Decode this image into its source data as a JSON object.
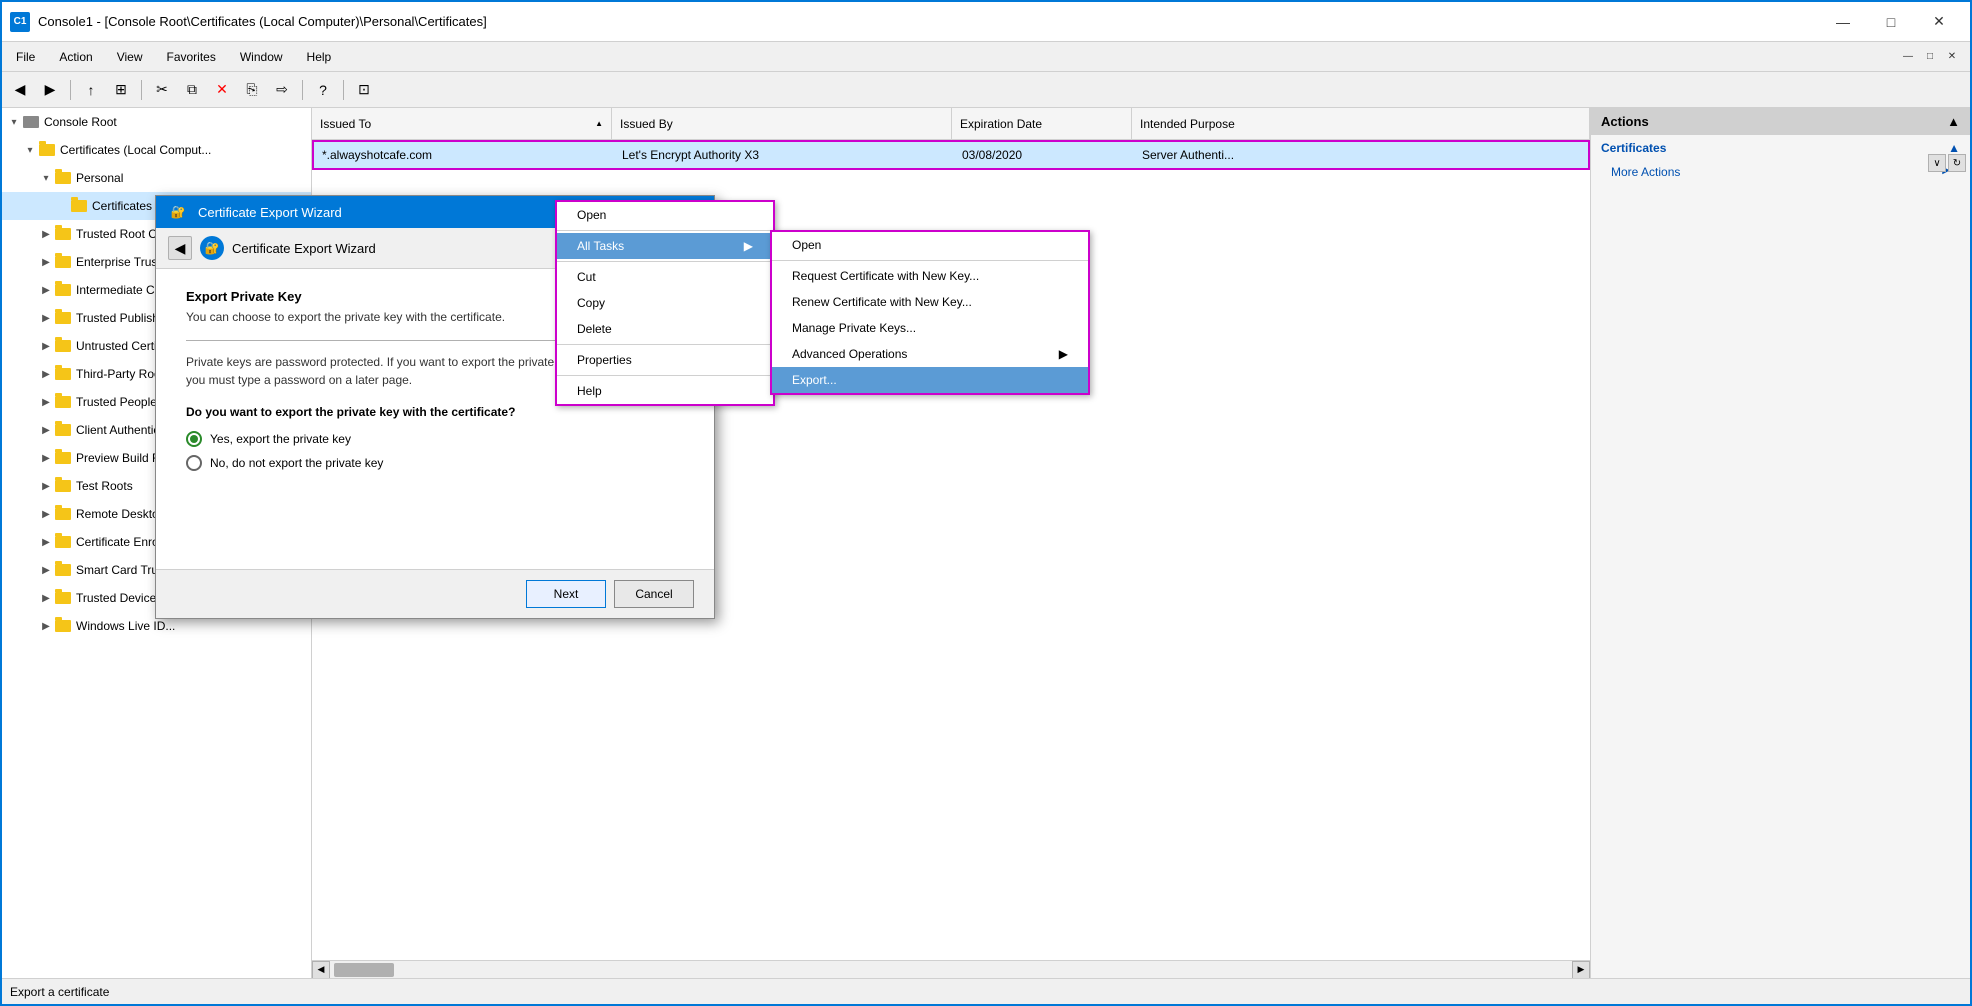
{
  "window": {
    "title": "Console1 - [Console Root\\Certificates (Local Computer)\\Personal\\Certificates]",
    "icon_label": "C1"
  },
  "titlebar": {
    "minimize": "—",
    "maximize": "□",
    "close": "✕"
  },
  "menubar": {
    "items": [
      "File",
      "Action",
      "View",
      "Favorites",
      "Window",
      "Help"
    ]
  },
  "toolbar": {
    "buttons": [
      "◀",
      "▶",
      "↑",
      "⊞",
      "✂",
      "⧉",
      "✕",
      "⎘",
      "⇨",
      "?",
      "⊡"
    ]
  },
  "tree": {
    "items": [
      {
        "label": "Console Root",
        "indent": 0,
        "expand": "▾",
        "icon": "computer",
        "id": "console-root"
      },
      {
        "label": "Certificates (Local Comput...",
        "indent": 1,
        "expand": "▾",
        "icon": "folder",
        "id": "certs-local"
      },
      {
        "label": "Personal",
        "indent": 2,
        "expand": "▾",
        "icon": "folder",
        "id": "personal"
      },
      {
        "label": "Certificates",
        "indent": 3,
        "expand": "",
        "icon": "folder",
        "id": "certificates",
        "selected": true
      },
      {
        "label": "Trusted Root Cert...",
        "indent": 2,
        "expand": "▶",
        "icon": "folder",
        "id": "trusted-root"
      },
      {
        "label": "Enterprise Trust",
        "indent": 2,
        "expand": "▶",
        "icon": "folder",
        "id": "enterprise-trust"
      },
      {
        "label": "Intermediate Cert",
        "indent": 2,
        "expand": "▶",
        "icon": "folder",
        "id": "intermediate-cert"
      },
      {
        "label": "Trusted Publisher",
        "indent": 2,
        "expand": "▶",
        "icon": "folder",
        "id": "trusted-publisher"
      },
      {
        "label": "Untrusted Certific...",
        "indent": 2,
        "expand": "▶",
        "icon": "folder",
        "id": "untrusted-cert"
      },
      {
        "label": "Third-Party Root...",
        "indent": 2,
        "expand": "▶",
        "icon": "folder",
        "id": "third-party-root"
      },
      {
        "label": "Trusted People",
        "indent": 2,
        "expand": "▶",
        "icon": "folder",
        "id": "trusted-people"
      },
      {
        "label": "Client Authentic...",
        "indent": 2,
        "expand": "▶",
        "icon": "folder",
        "id": "client-auth"
      },
      {
        "label": "Preview Build Ro...",
        "indent": 2,
        "expand": "▶",
        "icon": "folder",
        "id": "preview-build"
      },
      {
        "label": "Test Roots",
        "indent": 2,
        "expand": "▶",
        "icon": "folder",
        "id": "test-roots"
      },
      {
        "label": "Remote Desktop...",
        "indent": 2,
        "expand": "▶",
        "icon": "folder",
        "id": "remote-desktop"
      },
      {
        "label": "Certificate Enrol...",
        "indent": 2,
        "expand": "▶",
        "icon": "folder",
        "id": "cert-enroll"
      },
      {
        "label": "Smart Card Trus...",
        "indent": 2,
        "expand": "▶",
        "icon": "folder",
        "id": "smart-card"
      },
      {
        "label": "Trusted Devices",
        "indent": 2,
        "expand": "▶",
        "icon": "folder",
        "id": "trusted-devices"
      },
      {
        "label": "Windows Live ID...",
        "indent": 2,
        "expand": "▶",
        "icon": "folder",
        "id": "windows-live"
      }
    ]
  },
  "columns": {
    "headers": [
      "Issued To",
      "Issued By",
      "Expiration Date",
      "Intended Purpose"
    ]
  },
  "cert_row": {
    "issued_to": "*.alwayshotcafe.com",
    "issued_by": "Let's Encrypt Authority X3",
    "expiration": "03/08/2020",
    "purpose": "Server Authenti..."
  },
  "context_menu": {
    "items": [
      {
        "label": "Open",
        "id": "ctx-open",
        "highlighted": false
      },
      {
        "label": "All Tasks",
        "id": "ctx-all-tasks",
        "highlighted": true,
        "has_arrow": true
      },
      {
        "label": "Cut",
        "id": "ctx-cut",
        "highlighted": false
      },
      {
        "label": "Copy",
        "id": "ctx-copy",
        "highlighted": false
      },
      {
        "label": "Delete",
        "id": "ctx-delete",
        "highlighted": false
      },
      {
        "label": "Properties",
        "id": "ctx-properties",
        "highlighted": false
      },
      {
        "label": "Help",
        "id": "ctx-help",
        "highlighted": false
      }
    ],
    "separators_after": [
      0,
      1,
      4,
      5
    ]
  },
  "submenu": {
    "items": [
      {
        "label": "Open",
        "id": "sub-open",
        "highlighted": false
      },
      {
        "label": "Request Certificate with New Key...",
        "id": "sub-request",
        "highlighted": false
      },
      {
        "label": "Renew Certificate with New Key...",
        "id": "sub-renew",
        "highlighted": false
      },
      {
        "label": "Manage Private Keys...",
        "id": "sub-manage-keys",
        "highlighted": false
      },
      {
        "label": "Advanced Operations",
        "id": "sub-advanced",
        "highlighted": false,
        "has_arrow": true
      },
      {
        "label": "Export...",
        "id": "sub-export",
        "highlighted": true
      }
    ],
    "separators_after": [
      0
    ]
  },
  "actions_panel": {
    "header": "Actions",
    "certificates_label": "Certificates",
    "more_actions_label": "More Actions",
    "arrow": "▶"
  },
  "dialog": {
    "title": "Certificate Export Wizard",
    "nav_title": "Certificate Export Wizard",
    "section_title": "Export Private Key",
    "section_desc": "You can choose to export the private key with the certificate.",
    "body_text": "Private keys are password protected. If you want to export the private key with the certificate, you must type a password on a later page.",
    "question": "Do you want to export the private key with the certificate?",
    "radio_yes": "Yes, export the private key",
    "radio_no": "No, do not export the private key",
    "yes_selected": true,
    "btn_next": "Next",
    "btn_cancel": "Cancel"
  },
  "status_bar": {
    "text": "Export a certificate"
  },
  "colors": {
    "highlight_border": "#cc00cc",
    "selected_bg": "#cde8ff",
    "context_highlight": "#5b9bd5",
    "title_bar_bg": "#0078d7"
  }
}
